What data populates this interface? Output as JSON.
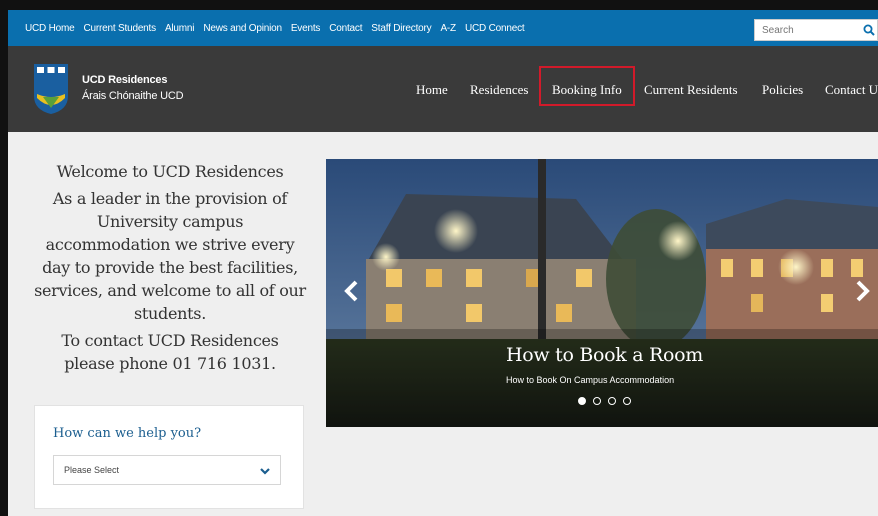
{
  "topbar": {
    "links": [
      "UCD Home",
      "Current Students",
      "Alumni",
      "News and Opinion",
      "Events",
      "Contact",
      "Staff Directory",
      "A-Z",
      "UCD Connect"
    ],
    "search_placeholder": "Search"
  },
  "header": {
    "site_title": "UCD Residences",
    "site_subtitle": "Árais Chónaithe UCD",
    "nav": [
      "Home",
      "Residences",
      "Booking Info",
      "Current Residents",
      "Policies",
      "Contact U"
    ]
  },
  "welcome": {
    "heading": "Welcome to UCD Residences",
    "body": "As a leader in the provision of University campus accommodation we strive every day to provide the best facilities, services, and welcome to all of our students.",
    "contact": "To contact UCD Residences please phone 01 716 1031."
  },
  "help": {
    "title": "How can we help you?",
    "select_value": "Please Select"
  },
  "carousel": {
    "title": "How to Book a Room",
    "subtitle": "How to Book On Campus Accommodation",
    "slide_count": 4,
    "active_slide": 1
  },
  "colors": {
    "topbar": "#0a6fae",
    "header": "#3a3a3a",
    "highlight": "#d11a2a",
    "help_title": "#1b5e8f"
  }
}
